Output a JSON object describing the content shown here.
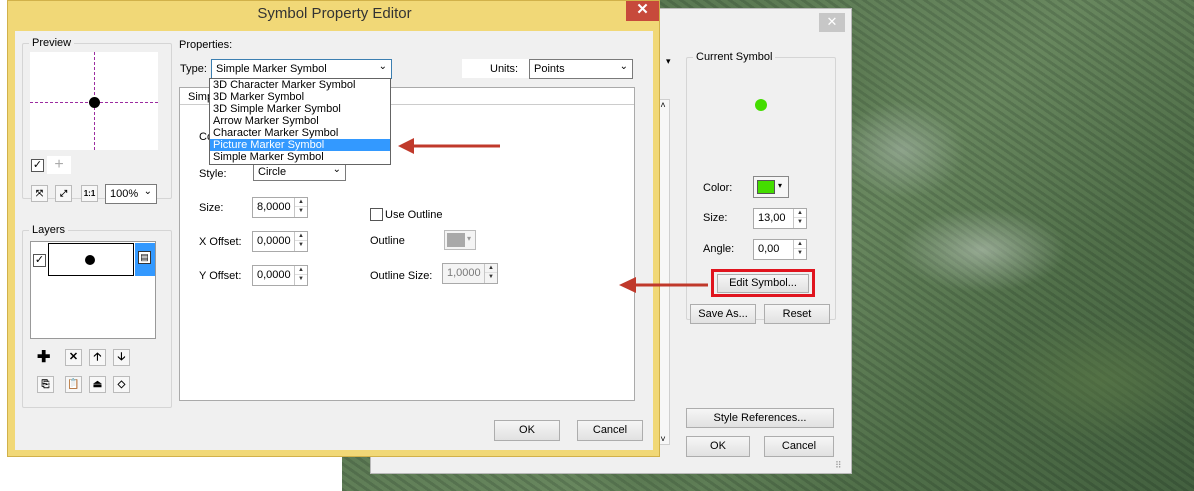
{
  "main_dialog": {
    "title": "Symbol Property Editor",
    "close": "✕",
    "preview_label": "Preview",
    "zoom_value": "100%",
    "layers_label": "Layers",
    "properties_label": "Properties:",
    "type_label": "Type:",
    "type_value": "Simple Marker Symbol",
    "units_label": "Units:",
    "units_value": "Points",
    "tab_label": "Simple",
    "color_label": "Colo",
    "style_label": "Style:",
    "style_value": "Circle",
    "size_label": "Size:",
    "size_value": "8,0000",
    "x_offset_label": "X Offset:",
    "x_offset_value": "0,0000",
    "y_offset_label": "Y Offset:",
    "y_offset_value": "0,0000",
    "use_outline_label": "Use Outline",
    "outline_label": "Outline",
    "outline_size_label": "Outline Size:",
    "outline_size_value": "1,0000",
    "ok": "OK",
    "cancel": "Cancel",
    "type_options": [
      "3D Character Marker Symbol",
      "3D Marker Symbol",
      "3D Simple Marker Symbol",
      "Arrow Marker Symbol",
      "Character Marker Symbol",
      "Picture Marker Symbol",
      "Simple Marker Symbol"
    ],
    "selected_option_index": 5
  },
  "back_dialog": {
    "close": "✕",
    "current_symbol_label": "Current Symbol",
    "color_label": "Color:",
    "size_label": "Size:",
    "size_value": "13,00",
    "angle_label": "Angle:",
    "angle_value": "0,00",
    "edit_symbol": "Edit Symbol...",
    "save_as": "Save As...",
    "reset": "Reset",
    "style_references": "Style References...",
    "ok": "OK",
    "cancel": "Cancel"
  },
  "colors": {
    "symbol_green": "#44dd00",
    "highlight_red": "#e0141e",
    "arrow_red": "#c0392b",
    "title_bar": "#f1d877",
    "selection_blue": "#3399ff"
  }
}
